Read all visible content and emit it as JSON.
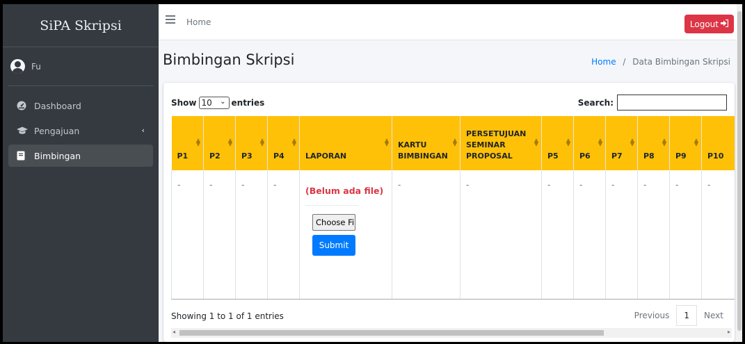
{
  "brand": "SiPA Skripsi",
  "user": {
    "name": "Fu"
  },
  "sidebar": {
    "items": [
      {
        "label": "Dashboard",
        "icon": "tachometer-icon"
      },
      {
        "label": "Pengajuan",
        "icon": "graduation-cap-icon",
        "chevron": "‹"
      },
      {
        "label": "Bimbingan",
        "icon": "book-icon",
        "active": true
      }
    ]
  },
  "topbar": {
    "home": "Home",
    "logout": "Logout"
  },
  "header": {
    "title": "Bimbingan Skripsi",
    "breadcrumb": {
      "home": "Home",
      "separator": "/",
      "current": "Data Bimbingan Skripsi"
    }
  },
  "table_controls": {
    "show_label": "Show",
    "length_value": "10",
    "entries_label": "entries",
    "search_label": "Search:"
  },
  "table": {
    "columns": [
      "P1",
      "P2",
      "P3",
      "P4",
      "LAPORAN",
      "KARTU BIMBINGAN",
      "PERSETUJUAN SEMINAR PROPOSAL",
      "P5",
      "P6",
      "P7",
      "P8",
      "P9",
      "P10"
    ],
    "row": {
      "cells": [
        "-",
        "-",
        "-",
        "-",
        "",
        "-",
        "-",
        "-",
        "-",
        "-",
        "-",
        "-",
        "-"
      ],
      "laporan_status": "(Belum ada file)",
      "choose_file": "Choose File",
      "submit": "Submit"
    }
  },
  "footer": {
    "info": "Showing 1 to 1 of 1 entries",
    "pagination": {
      "previous": "Previous",
      "current": "1",
      "next": "Next"
    }
  },
  "colors": {
    "sidebar": "#343a40",
    "header_row": "#ffc107",
    "logout": "#dc3545",
    "primary": "#007bff",
    "warning_text": "#dc3545"
  }
}
